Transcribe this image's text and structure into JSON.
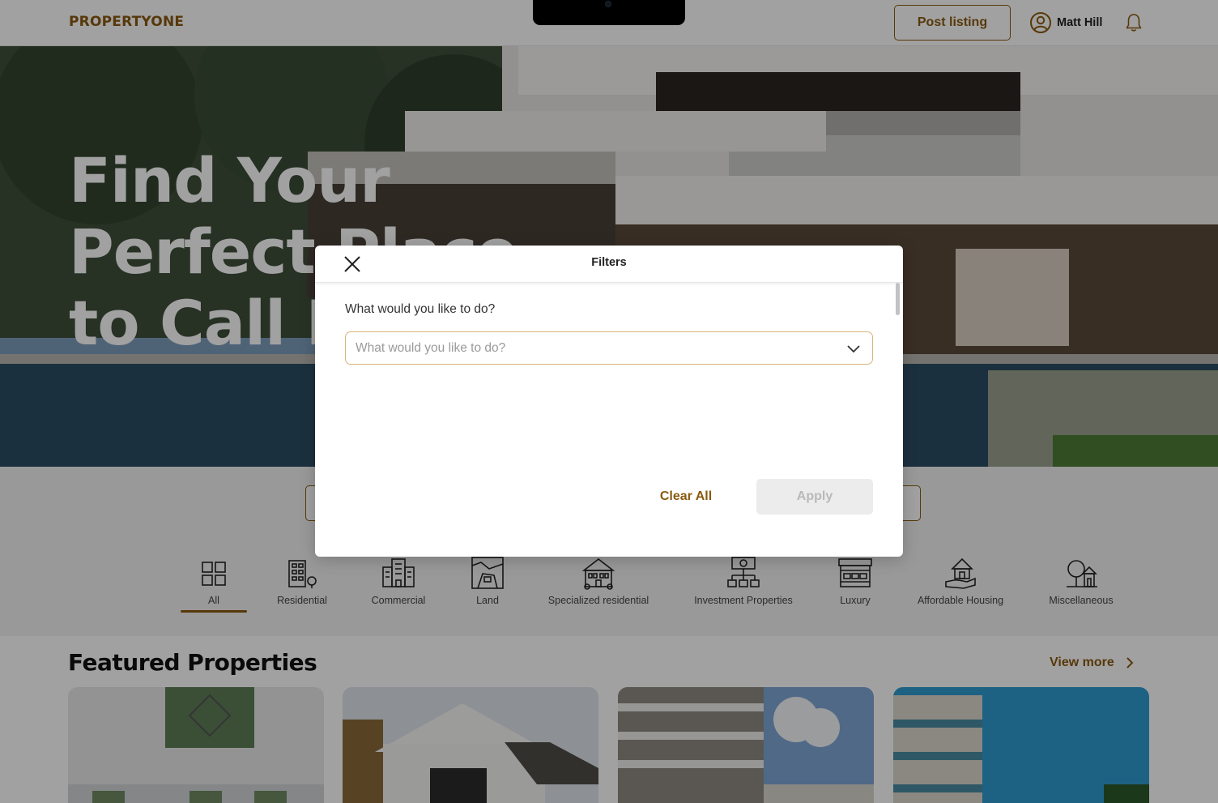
{
  "header": {
    "logo": "PROPERTYONE",
    "post_listing_label": "Post listing",
    "user_name": "Matt Hill"
  },
  "hero": {
    "title_lines": [
      "Find Your",
      "Perfect Place",
      "to Call Home"
    ]
  },
  "categories": {
    "active": "All",
    "items": [
      {
        "label": "All",
        "icon": "grid-icon"
      },
      {
        "label": "Residential",
        "icon": "residential-building-icon"
      },
      {
        "label": "Commercial",
        "icon": "commercial-buildings-icon"
      },
      {
        "label": "Land",
        "icon": "land-map-icon"
      },
      {
        "label": "Specialized residential",
        "icon": "mansion-icon"
      },
      {
        "label": "Investment Properties",
        "icon": "investment-network-icon"
      },
      {
        "label": "Luxury",
        "icon": "luxury-storefront-icon"
      },
      {
        "label": "Affordable Housing",
        "icon": "house-in-hand-icon"
      },
      {
        "label": "Miscellaneous",
        "icon": "tree-house-icon"
      }
    ]
  },
  "featured": {
    "title": "Featured Properties",
    "view_more_label": "View more"
  },
  "modal": {
    "title": "Filters",
    "question_label": "What would you like to do?",
    "select_placeholder": "What would you like to do?",
    "clear_label": "Clear All",
    "apply_label": "Apply"
  },
  "colors": {
    "brand": "#8a5a10",
    "overlay": "rgba(0,0,0,0.37)",
    "disabled_bg": "#ececec",
    "disabled_text": "#b9b9b9"
  }
}
